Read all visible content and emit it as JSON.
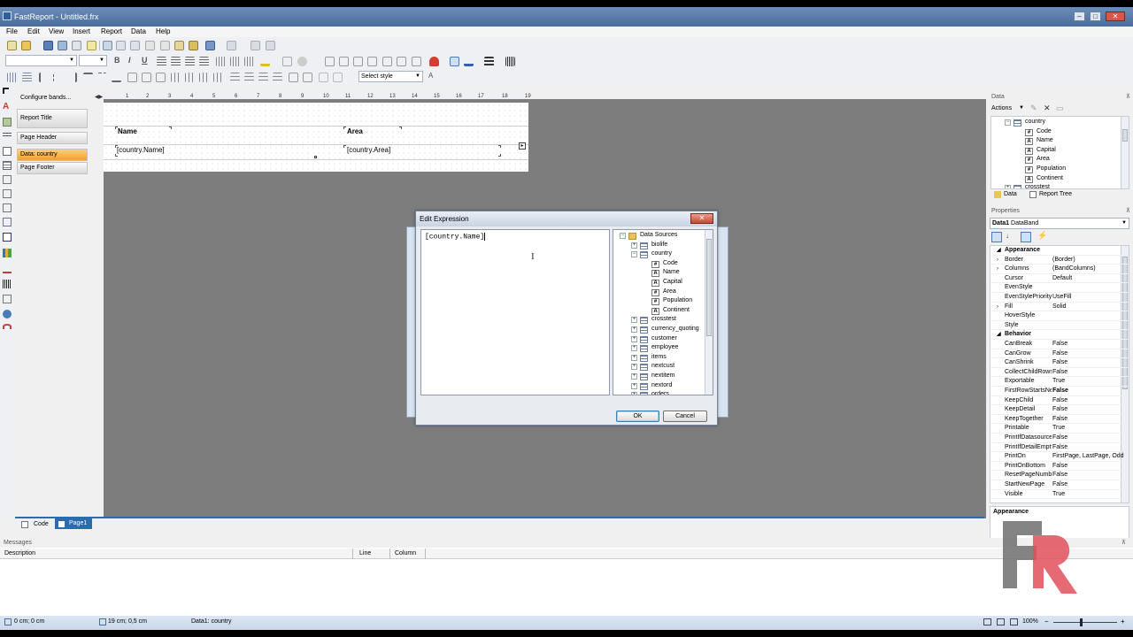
{
  "window": {
    "title": "FastReport - Untitled.frx",
    "min": "‒",
    "max": "□",
    "close": "✕"
  },
  "menu": [
    "File",
    "Edit",
    "View",
    "Insert",
    "Report",
    "Data",
    "Help"
  ],
  "toolbar": {
    "font_name": "",
    "font_size": "",
    "bold": "B",
    "italic": "I",
    "underline": "U",
    "style_combo": "Select style",
    "style_icon": "A",
    "configure_bands": "Configure bands..."
  },
  "bands": [
    "Report Title",
    "Page Header",
    "Data: country",
    "Page Footer"
  ],
  "ruler": [
    "1",
    "1",
    "2",
    "3",
    "4",
    "5",
    "6",
    "7",
    "8",
    "9",
    "10",
    "11",
    "12",
    "13",
    "14",
    "15",
    "16",
    "17",
    "18",
    "19"
  ],
  "report_page": {
    "header_name": "Name",
    "header_area": "Area",
    "data_name": "[country.Name]",
    "data_area": "[country.Area]"
  },
  "dialog": {
    "title": "Edit Expression",
    "close": "✕",
    "expression": "[country.Name]",
    "cursor": "I",
    "ok": "OK",
    "cancel": "Cancel",
    "tree": {
      "root": "Data Sources",
      "nodes": [
        {
          "label": "biolife",
          "level": 1,
          "kind": "table",
          "exp": "+"
        },
        {
          "label": "country",
          "level": 1,
          "kind": "table",
          "exp": "−"
        },
        {
          "label": "Code",
          "level": 2,
          "kind": "col",
          "glyph": "12"
        },
        {
          "label": "Name",
          "level": 2,
          "kind": "col",
          "glyph": "A"
        },
        {
          "label": "Capital",
          "level": 2,
          "kind": "col",
          "glyph": "A"
        },
        {
          "label": "Area",
          "level": 2,
          "kind": "col",
          "glyph": "12"
        },
        {
          "label": "Population",
          "level": 2,
          "kind": "col",
          "glyph": "12"
        },
        {
          "label": "Continent",
          "level": 2,
          "kind": "col",
          "glyph": "A"
        },
        {
          "label": "crosstest",
          "level": 1,
          "kind": "table",
          "exp": "+"
        },
        {
          "label": "currency_quoting",
          "level": 1,
          "kind": "table",
          "exp": "+"
        },
        {
          "label": "customer",
          "level": 1,
          "kind": "table",
          "exp": "+"
        },
        {
          "label": "employee",
          "level": 1,
          "kind": "table",
          "exp": "+"
        },
        {
          "label": "items",
          "level": 1,
          "kind": "table",
          "exp": "+"
        },
        {
          "label": "nextcust",
          "level": 1,
          "kind": "table",
          "exp": "+"
        },
        {
          "label": "nextitem",
          "level": 1,
          "kind": "table",
          "exp": "+"
        },
        {
          "label": "nextord",
          "level": 1,
          "kind": "table",
          "exp": "+"
        },
        {
          "label": "orders",
          "level": 1,
          "kind": "table",
          "exp": "+"
        }
      ]
    }
  },
  "data_panel": {
    "title": "Data",
    "actions": "Actions",
    "tree": [
      {
        "label": "country",
        "level": 0,
        "kind": "table"
      },
      {
        "label": "Code",
        "level": 1,
        "kind": "col",
        "glyph": "12"
      },
      {
        "label": "Name",
        "level": 1,
        "kind": "col",
        "glyph": "A"
      },
      {
        "label": "Capital",
        "level": 1,
        "kind": "col",
        "glyph": "A"
      },
      {
        "label": "Area",
        "level": 1,
        "kind": "col",
        "glyph": "12"
      },
      {
        "label": "Population",
        "level": 1,
        "kind": "col",
        "glyph": "12"
      },
      {
        "label": "Continent",
        "level": 1,
        "kind": "col",
        "glyph": "A"
      },
      {
        "label": "crosstest",
        "level": 0,
        "kind": "table"
      }
    ],
    "tab_data": "Data",
    "tab_tree": "Report Tree"
  },
  "properties_panel": {
    "title": "Properties",
    "object": "Data1",
    "object_type": "DataBand",
    "rows": [
      {
        "cat": true,
        "label": "Appearance"
      },
      {
        "label": "Border",
        "value": "(Border)",
        "exp": "›"
      },
      {
        "label": "Columns",
        "value": "(BandColumns)",
        "exp": "›"
      },
      {
        "label": "Cursor",
        "value": "Default"
      },
      {
        "label": "EvenStyle",
        "value": ""
      },
      {
        "label": "EvenStylePriority",
        "value": "UseFill"
      },
      {
        "label": "Fill",
        "value": "Solid",
        "exp": "›"
      },
      {
        "label": "HoverStyle",
        "value": ""
      },
      {
        "label": "Style",
        "value": ""
      },
      {
        "cat": true,
        "label": "Behavior"
      },
      {
        "label": "CanBreak",
        "value": "False"
      },
      {
        "label": "CanGrow",
        "value": "False"
      },
      {
        "label": "CanShrink",
        "value": "False"
      },
      {
        "label": "CollectChildRows",
        "value": "False"
      },
      {
        "label": "Exportable",
        "value": "True"
      },
      {
        "label": "FirstRowStartsNewPage",
        "value": "False"
      },
      {
        "label": "KeepChild",
        "value": "False"
      },
      {
        "label": "KeepDetail",
        "value": "False"
      },
      {
        "label": "KeepTogether",
        "value": "False"
      },
      {
        "label": "Printable",
        "value": "True"
      },
      {
        "label": "PrintIfDatasourceEmpty",
        "value": "False"
      },
      {
        "label": "PrintIfDetailEmpty",
        "value": "False"
      },
      {
        "label": "PrintOn",
        "value": "FirstPage, LastPage, Odd"
      },
      {
        "label": "PrintOnBottom",
        "value": "False"
      },
      {
        "label": "ResetPageNumber",
        "value": "False"
      },
      {
        "label": "StartNewPage",
        "value": "False"
      },
      {
        "label": "Visible",
        "value": "True"
      }
    ],
    "desc_title": "Appearance"
  },
  "page_tabs": {
    "code": "Code",
    "page1": "Page1"
  },
  "messages": {
    "title": "Messages",
    "col_desc": "Description",
    "col_line": "Line",
    "col_column": "Column"
  },
  "status": {
    "pos": "0 cm; 0 cm",
    "size": "19 cm; 0,5 cm",
    "object": "Data1:  country",
    "zoom": "100%"
  },
  "colors": {
    "accent": "#2b6cb0",
    "band_active": "#f0a030",
    "canvas": "#7d7d7d",
    "logo_gray": "#6f6f6f",
    "logo_red": "#e0505a"
  }
}
